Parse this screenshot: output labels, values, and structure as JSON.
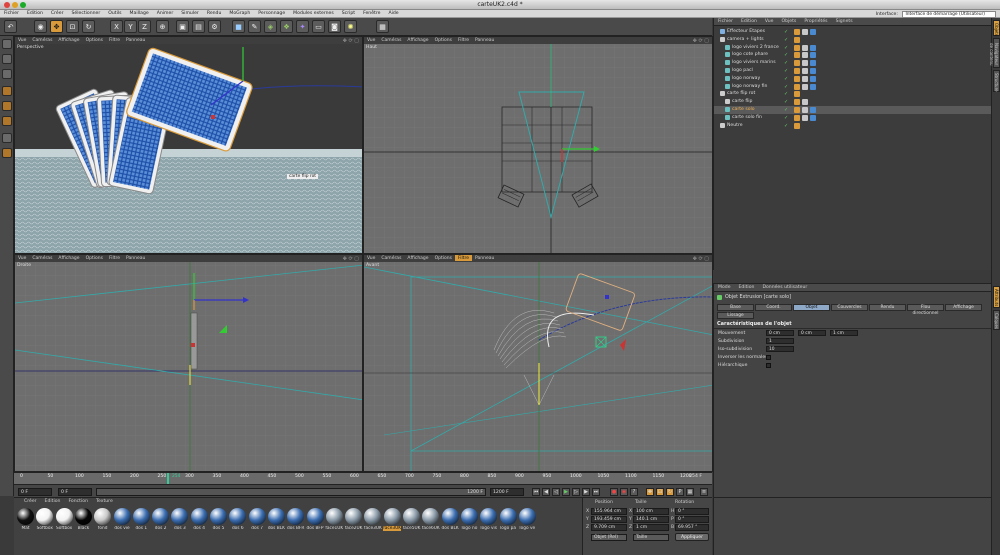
{
  "window": {
    "title": "carteUK2.c4d *"
  },
  "menubar": {
    "items": [
      "Fichier",
      "Edition",
      "Créer",
      "Sélectionner",
      "Outils",
      "Maillage",
      "Animer",
      "Simuler",
      "Rendu",
      "MoGraph",
      "Personnage",
      "Modules externes",
      "Script",
      "Fenêtre",
      "Aide"
    ],
    "interface_label": "Interface:",
    "interface_value": "Interface de démarrage (Utilisateur)"
  },
  "toolbar": {
    "axis_buttons": [
      "X",
      "Y",
      "Z"
    ]
  },
  "viewport_menu": [
    "Vue",
    "Caméras",
    "Affichage",
    "Options",
    "Filtre",
    "Panneau"
  ],
  "viewports": {
    "perspective": {
      "label": "Perspective",
      "tooltip": "carte flip rot"
    },
    "top": {
      "label": "Haut"
    },
    "right": {
      "label": "Droite"
    },
    "front": {
      "label": "Avant"
    }
  },
  "timeline": {
    "ticks": [
      "0",
      "50",
      "100",
      "150",
      "200",
      "250",
      "300",
      "350",
      "400",
      "450",
      "500",
      "550",
      "600",
      "650",
      "700",
      "750",
      "800",
      "850",
      "900",
      "950",
      "1000",
      "1050",
      "1100",
      "1150",
      "1200"
    ],
    "current_marker": "254",
    "end_label": "254 F",
    "current_frame": "0 F",
    "range_start": "0 F",
    "range_mid": "1200 F",
    "range_end": "1200 F"
  },
  "materials": {
    "menu": [
      "Créer",
      "Edition",
      "Fonction",
      "Texture"
    ],
    "items": [
      {
        "label": "Mat",
        "color": "#111111"
      },
      {
        "label": "Softbox",
        "color": "#f2f2f2"
      },
      {
        "label": "Softbox",
        "color": "#f2f2f2"
      },
      {
        "label": "Black",
        "color": "#050505"
      },
      {
        "label": "fond",
        "color": "#c8c8c8"
      },
      {
        "label": "dos vie",
        "color": "#3b6db0"
      },
      {
        "label": "dos 1",
        "color": "#3b6db0"
      },
      {
        "label": "dos 2",
        "color": "#3b6db0"
      },
      {
        "label": "dos 3",
        "color": "#3b6db0"
      },
      {
        "label": "dos 4",
        "color": "#3b6db0"
      },
      {
        "label": "dos 5",
        "color": "#3b6db0"
      },
      {
        "label": "dos 6",
        "color": "#3b6db0"
      },
      {
        "label": "dos 7",
        "color": "#3b6db0"
      },
      {
        "label": "dos BLK",
        "color": "#3b6db0"
      },
      {
        "label": "dos BFR",
        "color": "#3b6db0"
      },
      {
        "label": "dos BFP",
        "color": "#3b6db0"
      },
      {
        "label": "face1UK",
        "color": "#8a9aa8"
      },
      {
        "label": "face2UK",
        "color": "#8a9aa8"
      },
      {
        "label": "face3UK",
        "color": "#8a9aa8"
      },
      {
        "label": "face3UK",
        "color": "#8a9aa8"
      },
      {
        "label": "face5UK",
        "color": "#8a9aa8"
      },
      {
        "label": "face6UK",
        "color": "#8a9aa8"
      },
      {
        "label": "dos BLK",
        "color": "#3b6db0"
      },
      {
        "label": "logo no",
        "color": "#3b6db0"
      },
      {
        "label": "logo vis",
        "color": "#3b6db0"
      },
      {
        "label": "logo pa",
        "color": "#3b6db0"
      },
      {
        "label": "logo ve",
        "color": "#3b6db0"
      }
    ],
    "highlight_index": 19
  },
  "coordinates": {
    "headers": [
      "Position",
      "Taille",
      "Rotation"
    ],
    "rows": [
      {
        "axis": "X",
        "pos": "155.964 cm",
        "size_axis": "X",
        "size": "100 cm",
        "rot_axis": "H",
        "rot": "0 °"
      },
      {
        "axis": "Y",
        "pos": "193.459 cm",
        "size_axis": "Y",
        "size": "140.1 cm",
        "rot_axis": "P",
        "rot": "0 °"
      },
      {
        "axis": "Z",
        "pos": "9.709 cm",
        "size_axis": "Z",
        "size": "1 cm",
        "rot_axis": "B",
        "rot": "69.957 °"
      }
    ],
    "mode_select": "Objet (Rel)",
    "size_select": "Taille",
    "apply": "Appliquer"
  },
  "object_manager": {
    "menu": [
      "Fichier",
      "Edition",
      "Vue",
      "Objets",
      "Propriétés",
      "Signets"
    ],
    "objects": [
      {
        "name": "Effecteur Etapes",
        "indent": 0,
        "icon": "#7fb0e0"
      },
      {
        "name": "camera + lights",
        "indent": 0,
        "icon": "#cccccc"
      },
      {
        "name": "logo viviers 2 france",
        "indent": 1,
        "icon": "#6cc0c0"
      },
      {
        "name": "logo cote phare",
        "indent": 1,
        "icon": "#6cc0c0"
      },
      {
        "name": "logo viviers marins",
        "indent": 1,
        "icon": "#6cc0c0"
      },
      {
        "name": "logo pacl",
        "indent": 1,
        "icon": "#6cc0c0"
      },
      {
        "name": "logo norway",
        "indent": 1,
        "icon": "#6cc0c0"
      },
      {
        "name": "logo norway fin",
        "indent": 1,
        "icon": "#6cc0c0"
      },
      {
        "name": "carte flip rot",
        "indent": 0,
        "icon": "#cccccc"
      },
      {
        "name": "carte flip",
        "indent": 1,
        "icon": "#cccccc"
      },
      {
        "name": "carte solo",
        "indent": 1,
        "icon": "#6cc0c0"
      },
      {
        "name": "carte solo fin",
        "indent": 1,
        "icon": "#6cc0c0"
      },
      {
        "name": "Neutre",
        "indent": 0,
        "icon": "#cccccc"
      }
    ],
    "selected_index": 10
  },
  "attributes": {
    "menu": [
      "Mode",
      "Edition",
      "Données utilisateur"
    ],
    "object_title": "Objet Extrusion [carte solo]",
    "tabs": [
      "Base",
      "Coord.",
      "Objet",
      "Couvercles",
      "Rendu",
      "Flou directionnel",
      "Affichage",
      "Lissage"
    ],
    "active_tab": "Objet",
    "section": "Caractéristiques de l'objet",
    "fields": {
      "mouvement_label": "Mouvement",
      "mouvement": [
        "0 cm",
        "0 cm",
        "1 cm"
      ],
      "subdivision_label": "Subdivision",
      "subdivision": "1",
      "iso_label": "Iso-subdivision",
      "iso": "10",
      "invert_label": "Inverser les normales",
      "hier_label": "Hiérarchique"
    }
  },
  "side_tabs": {
    "top": [
      "Objets",
      "Navigateur de contenu",
      "Structure"
    ],
    "bottom": [
      "Attributs",
      "Calques"
    ]
  }
}
